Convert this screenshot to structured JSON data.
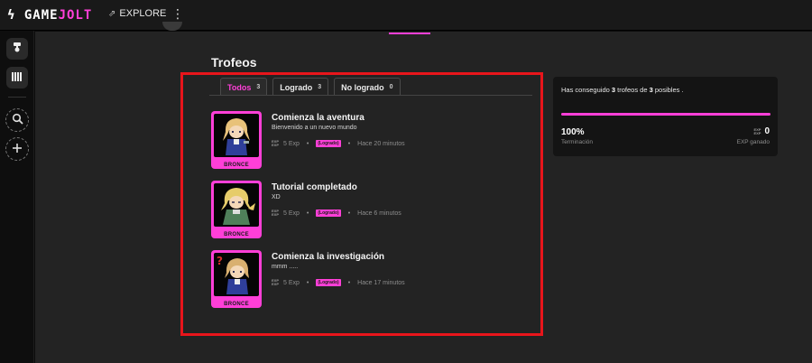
{
  "topbar": {
    "logo_game": "GAME",
    "logo_jolt": "JOLT",
    "explore_label": "EXPLORE",
    "more_icon": "vertical-dots-icon"
  },
  "sidebar": {
    "items": [
      {
        "icon": "game-controller-icon",
        "glyph": "🕹"
      },
      {
        "icon": "library-icon",
        "glyph": "▥"
      },
      {
        "icon": "search-icon",
        "glyph": "⌕"
      },
      {
        "icon": "add-icon",
        "glyph": "+"
      }
    ]
  },
  "page": {
    "title": "Trofeos",
    "tabs": [
      {
        "label": "Todos",
        "count": "3",
        "active": true
      },
      {
        "label": "Logrado",
        "count": "3",
        "active": false
      },
      {
        "label": "No logrado",
        "count": "0",
        "active": false
      }
    ]
  },
  "exp_icon_text": "EXP\nEXP",
  "trophies": [
    {
      "title": "Comienza la aventura",
      "description": "Bienvenido a un nuevo mundo",
      "exp": "5 Exp",
      "status": "(Logrado)",
      "time": "Hace 20 minutos",
      "tier": "BRONCE"
    },
    {
      "title": "Tutorial completado",
      "description": "XD",
      "exp": "5 Exp",
      "status": "(Logrado)",
      "time": "Hace 6 minutos",
      "tier": "BRONCE"
    },
    {
      "title": "Comienza la investigación",
      "description": "mmm .....",
      "exp": "5 Exp",
      "status": "(Logrado)",
      "time": "Hace 17 minutos",
      "tier": "BRONCE"
    }
  ],
  "summary": {
    "text_prefix": "Has conseguido",
    "achieved": "3",
    "text_middle": "trofeos de",
    "total": "3",
    "text_suffix": "posibles .",
    "progress_fraction": 1.0,
    "percent": "100%",
    "percent_label": "Terminación",
    "exp_value": "0",
    "exp_label": "EXP ganado"
  },
  "colors": {
    "accent": "#ff3fd8",
    "highlight": "#e8151b",
    "background": "#232323"
  }
}
